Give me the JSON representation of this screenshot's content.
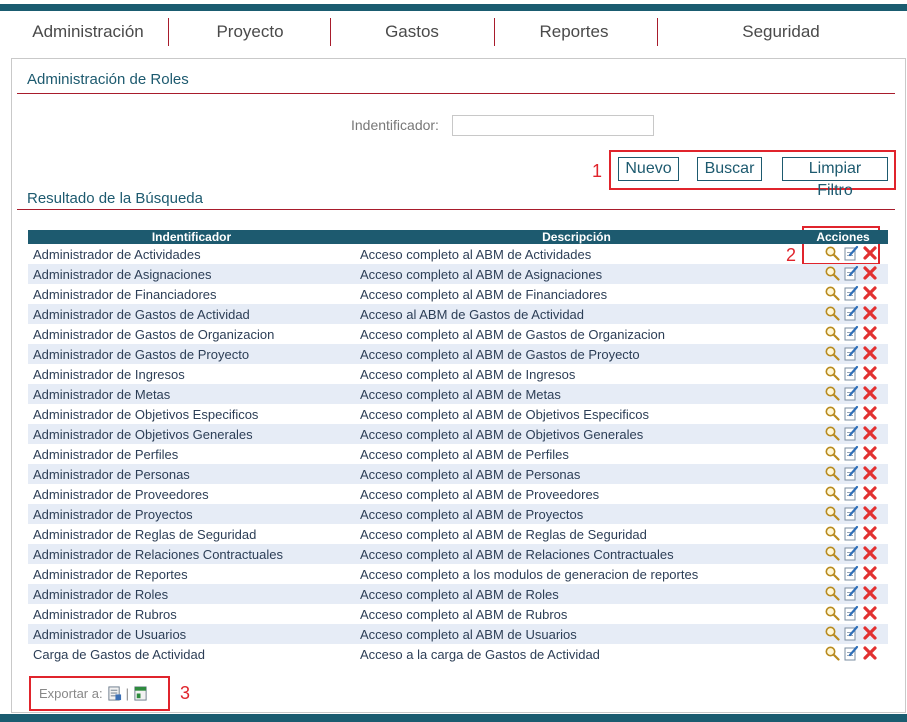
{
  "nav": {
    "items": [
      "Administración",
      "Proyecto",
      "Gastos",
      "Reportes",
      "Seguridad"
    ]
  },
  "page": {
    "title": "Administración de Roles"
  },
  "filter": {
    "label": "Indentificador:",
    "value": ""
  },
  "buttons": {
    "nuevo": "Nuevo",
    "buscar": "Buscar",
    "limpiar": "Limpiar Filtro"
  },
  "results": {
    "title": "Resultado de la Búsqueda",
    "headers": {
      "identificador": "Indentificador",
      "descripcion": "Descripción",
      "acciones": "Acciones"
    },
    "rows": [
      {
        "id": "Administrador de Actividades",
        "desc": "Acceso completo al ABM de Actividades"
      },
      {
        "id": "Administrador de Asignaciones",
        "desc": "Acceso completo al ABM de Asignaciones"
      },
      {
        "id": "Administrador de Financiadores",
        "desc": "Acceso completo al ABM de Financiadores"
      },
      {
        "id": "Administrador de Gastos de Actividad",
        "desc": "Acceso al ABM de Gastos de Actividad"
      },
      {
        "id": "Administrador de Gastos de Organizacion",
        "desc": "Acceso completo al ABM de Gastos de Organizacion"
      },
      {
        "id": "Administrador de Gastos de Proyecto",
        "desc": "Acceso completo al ABM de Gastos de Proyecto"
      },
      {
        "id": "Administrador de Ingresos",
        "desc": "Acceso completo al ABM de Ingresos"
      },
      {
        "id": "Administrador de Metas",
        "desc": "Acceso completo al ABM de Metas"
      },
      {
        "id": "Administrador de Objetivos Especificos",
        "desc": "Acceso completo al ABM de Objetivos Especificos"
      },
      {
        "id": "Administrador de Objetivos Generales",
        "desc": "Acceso completo al ABM de Objetivos Generales"
      },
      {
        "id": "Administrador de Perfiles",
        "desc": "Acceso completo al ABM de Perfiles"
      },
      {
        "id": "Administrador de Personas",
        "desc": "Acceso completo al ABM de Personas"
      },
      {
        "id": "Administrador de Proveedores",
        "desc": "Acceso completo al ABM de Proveedores"
      },
      {
        "id": "Administrador de Proyectos",
        "desc": "Acceso completo al ABM de Proyectos"
      },
      {
        "id": "Administrador de Reglas de Seguridad",
        "desc": "Acceso completo al ABM de Reglas de Seguridad"
      },
      {
        "id": "Administrador de Relaciones Contractuales",
        "desc": "Acceso completo al ABM de Relaciones Contractuales"
      },
      {
        "id": "Administrador de Reportes",
        "desc": "Acceso completo a los modulos de generacion de reportes"
      },
      {
        "id": "Administrador de Roles",
        "desc": "Acceso completo al ABM de Roles"
      },
      {
        "id": "Administrador de Rubros",
        "desc": "Acceso completo al ABM de Rubros"
      },
      {
        "id": "Administrador de Usuarios",
        "desc": "Acceso completo al ABM de Usuarios"
      },
      {
        "id": "Carga de Gastos de Actividad",
        "desc": "Acceso a la carga de Gastos de Actividad"
      }
    ],
    "row_actions": [
      "view-icon",
      "edit-icon",
      "delete-icon"
    ]
  },
  "export": {
    "label": "Exportar a:",
    "separator": "|",
    "formats": [
      "pdf-export-icon",
      "excel-export-icon"
    ]
  },
  "annotations": {
    "buttons_marker": "1",
    "actions_marker": "2",
    "export_marker": "3"
  },
  "colors": {
    "brand": "#1d5a6f",
    "accent": "#a81c2c",
    "annotation": "#e0242c",
    "row_alt": "#e6ecf6"
  }
}
